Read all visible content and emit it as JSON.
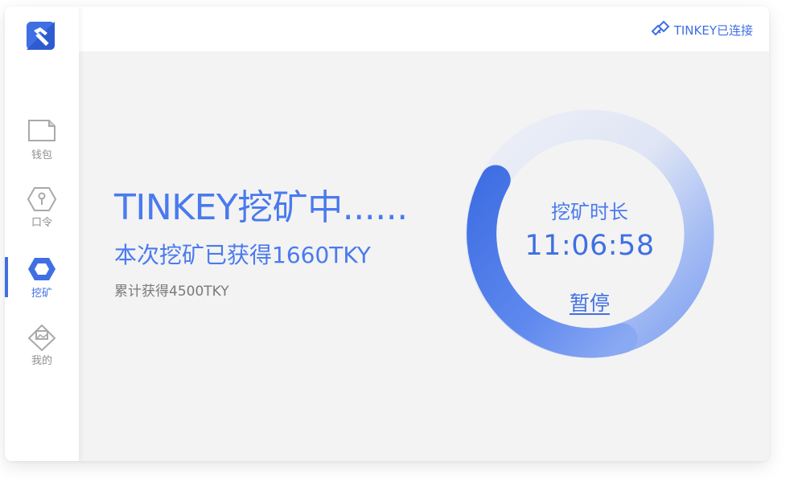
{
  "sidebar": {
    "logo_icon": "hammer-logo-icon",
    "items": [
      {
        "label": "钱包",
        "icon": "wallet-icon"
      },
      {
        "label": "口令",
        "icon": "key-hexagon-icon"
      },
      {
        "label": "挖矿",
        "icon": "mining-hexagon-icon",
        "active": true
      },
      {
        "label": "我的",
        "icon": "profile-diamond-icon"
      }
    ]
  },
  "header": {
    "connection_icon": "tinkey-device-icon",
    "connection_status": "TINKEY已连接"
  },
  "main": {
    "title": "TINKEY挖矿中......",
    "earned_text": "本次挖矿已获得1660TKY",
    "total_text": "累计获得4500TKY"
  },
  "timer": {
    "label": "挖矿时长",
    "time": "11:06:58",
    "pause_label": "暂停"
  },
  "colors": {
    "accent": "#3f6fe3",
    "text_blue": "#4a7aee",
    "background": "#f3f3f3",
    "inactive": "#8f8f8f"
  }
}
